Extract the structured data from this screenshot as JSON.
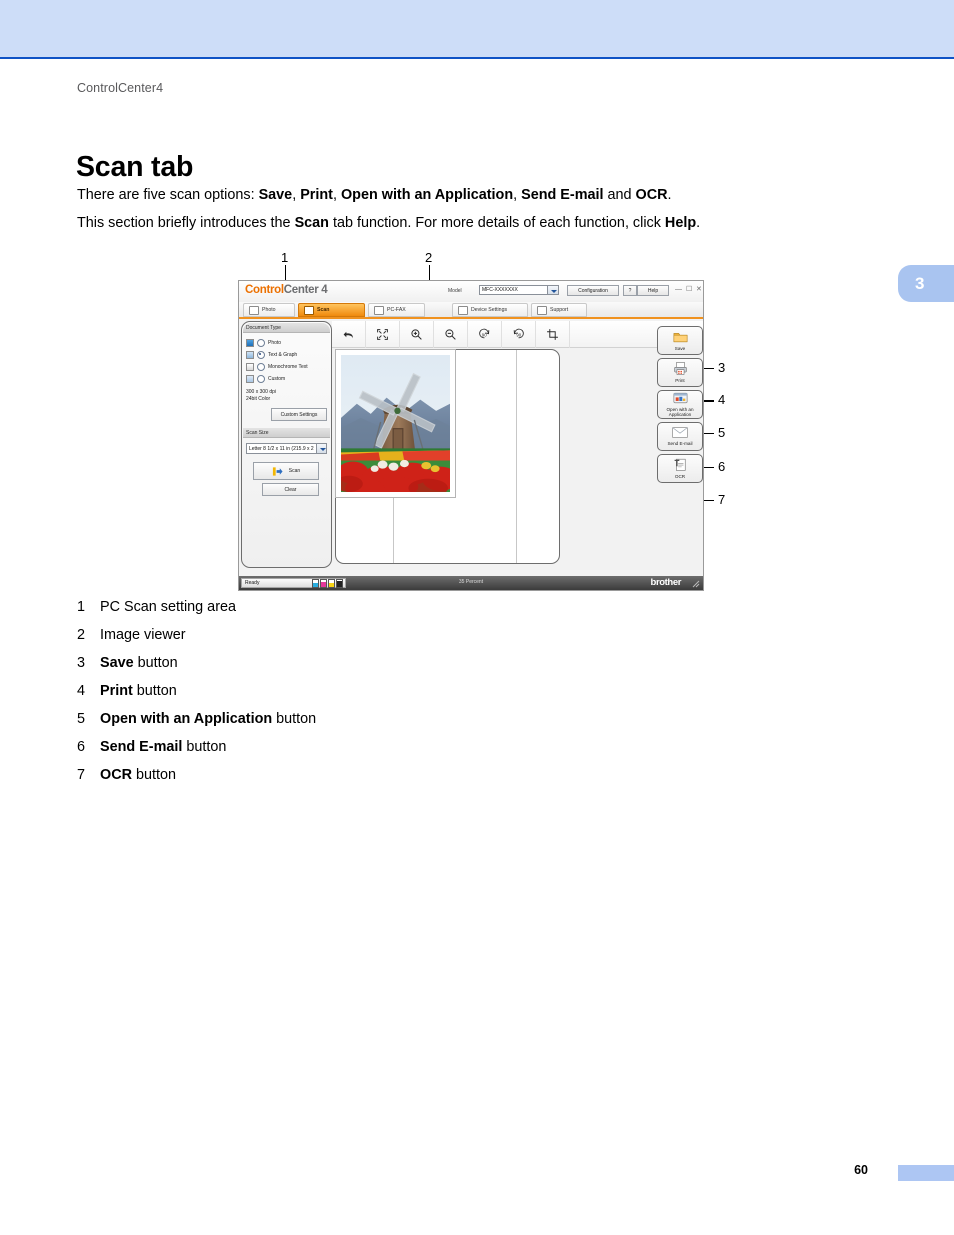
{
  "document": {
    "breadcrumb": "ControlCenter4",
    "title": "Scan tab",
    "chapter_marker": "3",
    "page_number": "60",
    "paragraph1": {
      "seg1": "There are five scan options: ",
      "b1": "Save",
      "seg2": ", ",
      "b2": "Print",
      "seg3": ", ",
      "b3": "Open with an Application",
      "seg4": ", ",
      "b4": "Send E-mail",
      "seg5": " and ",
      "b5": "OCR",
      "seg6": "."
    },
    "paragraph2": {
      "seg1": "This section briefly introduces the ",
      "b1": "Scan",
      "seg2": " tab function. For more details of each function, click ",
      "b2": "Help",
      "seg3": "."
    }
  },
  "callouts": [
    {
      "num": "1"
    },
    {
      "num": "2"
    },
    {
      "num": "3"
    },
    {
      "num": "4"
    },
    {
      "num": "5"
    },
    {
      "num": "6"
    },
    {
      "num": "7"
    }
  ],
  "legend": [
    {
      "num": "1",
      "bold": "",
      "text": "PC Scan setting area"
    },
    {
      "num": "2",
      "bold": "",
      "text": "Image viewer"
    },
    {
      "num": "3",
      "bold": "Save",
      "text": " button"
    },
    {
      "num": "4",
      "bold": "Print",
      "text": " button"
    },
    {
      "num": "5",
      "bold": "Open with an Application",
      "text": " button"
    },
    {
      "num": "6",
      "bold": "Send E-mail",
      "text": " button"
    },
    {
      "num": "7",
      "bold": "OCR",
      "text": " button"
    }
  ],
  "app": {
    "brand_bold": "Control",
    "brand_light": "Center 4",
    "model_label": "Model",
    "model_value": "MFC-XXXXXXX",
    "configuration_button": "Configuration",
    "question_button": "?",
    "help_button": "Help",
    "window_minimize": "—",
    "window_maximize": "☐",
    "window_close": "✕",
    "tabs": [
      {
        "label": "Photo",
        "icon": "photo-icon",
        "active": false
      },
      {
        "label": "Scan",
        "icon": "scan-icon",
        "active": true
      },
      {
        "label": "PC-FAX",
        "icon": "fax-icon",
        "active": false
      },
      {
        "label": "Device Settings",
        "icon": "device-settings-icon",
        "active": false
      },
      {
        "label": "Support",
        "icon": "support-icon",
        "active": false
      }
    ],
    "toolbar": [
      {
        "name": "undo-icon"
      },
      {
        "name": "fit-to-window-icon"
      },
      {
        "name": "zoom-in-icon"
      },
      {
        "name": "zoom-out-icon"
      },
      {
        "name": "rotate-left-90-icon"
      },
      {
        "name": "rotate-right-90-icon"
      },
      {
        "name": "crop-icon"
      }
    ],
    "left_panel": {
      "document_type_header": "Document Type",
      "options": [
        {
          "label": "Photo",
          "selected": false
        },
        {
          "label": "Text & Graph",
          "selected": true
        },
        {
          "label": "Monochrome Text",
          "selected": false
        },
        {
          "label": "Custom",
          "selected": false
        }
      ],
      "resolution": "300 x 300 dpi",
      "color_depth": "24bit Color",
      "custom_settings_button": "Custom Settings",
      "scan_size_header": "Scan Size",
      "scan_size_value": "Letter 8 1/2 x 11 in (215.9 x 2",
      "scan_button": "Scan",
      "clear_button": "Clear"
    },
    "action_buttons": [
      {
        "label": "Save",
        "icon": "folder-icon"
      },
      {
        "label": "Print",
        "icon": "printer-icon"
      },
      {
        "label": "Open with an\nApplication",
        "icon": "application-icon"
      },
      {
        "label": "Send E-mail",
        "icon": "envelope-icon"
      },
      {
        "label": "OCR",
        "icon": "ocr-icon"
      }
    ],
    "status_bar": {
      "state": "Ready",
      "zoom_percent": "35 Percent",
      "brand": "brother",
      "inks": [
        {
          "name": "cyan-ink",
          "color": "#29aee0",
          "level": 55
        },
        {
          "name": "magenta-ink",
          "color": "#e3379a",
          "level": 70
        },
        {
          "name": "yellow-ink",
          "color": "#f7d417",
          "level": 60
        },
        {
          "name": "black-ink",
          "color": "#222222",
          "level": 80
        }
      ]
    },
    "viewer": {
      "image_alt": "windmill-tulip-field-photo"
    }
  },
  "colors": {
    "band": "#cdddf8",
    "band_border": "#1053c6",
    "chapter_tab": "#a9c4f0",
    "accent_orange": "#f0921f"
  }
}
